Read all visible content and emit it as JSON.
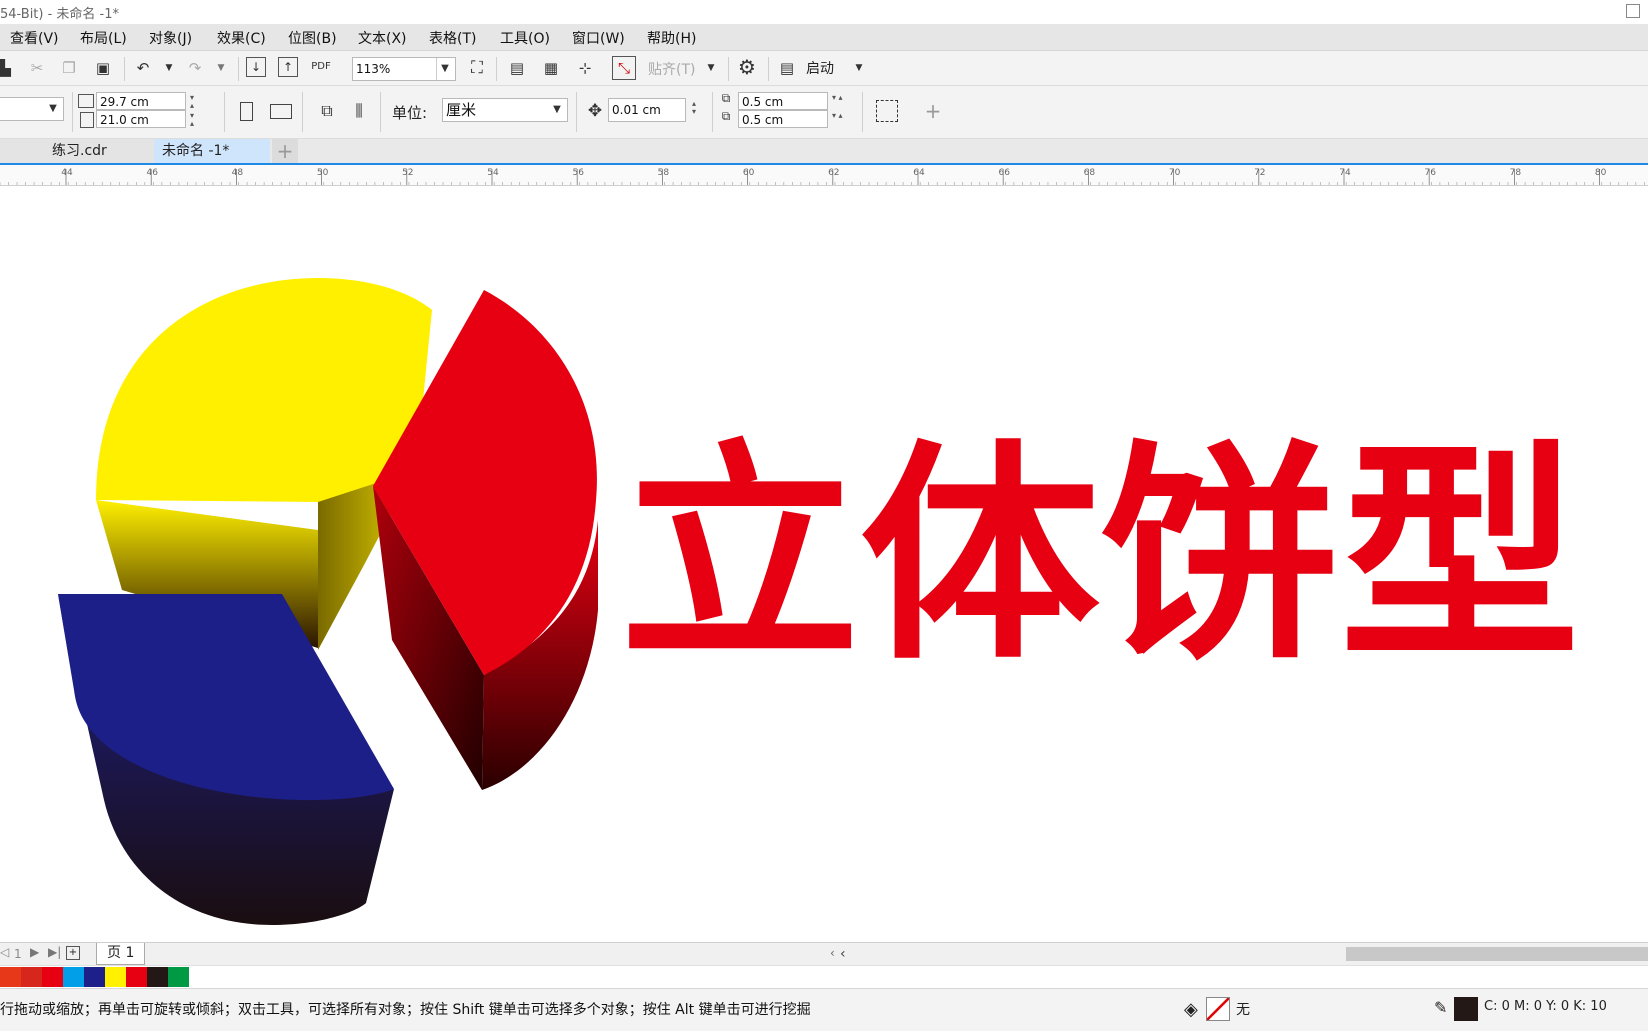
{
  "window": {
    "title": "54-Bit) - 未命名 -1*"
  },
  "menu": [
    "查看(V)",
    "布局(L)",
    "对象(J)",
    "效果(C)",
    "位图(B)",
    "文本(X)",
    "表格(T)",
    "工具(O)",
    "窗口(W)",
    "帮助(H)"
  ],
  "toolbar": {
    "zoom": "113%",
    "snap_label": "贴齐(T)",
    "launch_label": "启动",
    "pdf_label": "PDF"
  },
  "property_bar": {
    "width": "29.7 cm",
    "height": "21.0 cm",
    "unit_label": "单位:",
    "unit_value": "厘米",
    "nudge": "0.01 cm",
    "dup_x": "0.5 cm",
    "dup_y": "0.5 cm"
  },
  "tabs": [
    {
      "label": "练习.cdr",
      "active": false
    },
    {
      "label": "未命名 -1*",
      "active": true
    }
  ],
  "ruler_ticks": [
    "44",
    "46",
    "48",
    "50",
    "52",
    "54",
    "56",
    "58",
    "60",
    "62",
    "64",
    "66",
    "68",
    "70",
    "72",
    "74",
    "76",
    "78",
    "80"
  ],
  "canvas": {
    "headline": "立体饼型",
    "headline_color": "#e60012",
    "pie_colors": {
      "yellow": "#fff000",
      "red": "#e60012",
      "blue": "#1c1f87"
    }
  },
  "page_nav": {
    "page_count": "1",
    "page_tab": "页 1"
  },
  "palette": [
    "#e8381a",
    "#d7261c",
    "#e60012",
    "#009fe8",
    "#1c2088",
    "#fff100",
    "#e60012",
    "#231815",
    "#009944"
  ],
  "status": {
    "hint": "行拖动或缩放；再单击可旋转或倾斜；双击工具，可选择所有对象；按住 Shift 键单击可选择多个对象；按住 Alt 键单击可进行挖掘",
    "fill_label": "无",
    "color_readout": "C: 0 M: 0 Y: 0 K: 10"
  }
}
